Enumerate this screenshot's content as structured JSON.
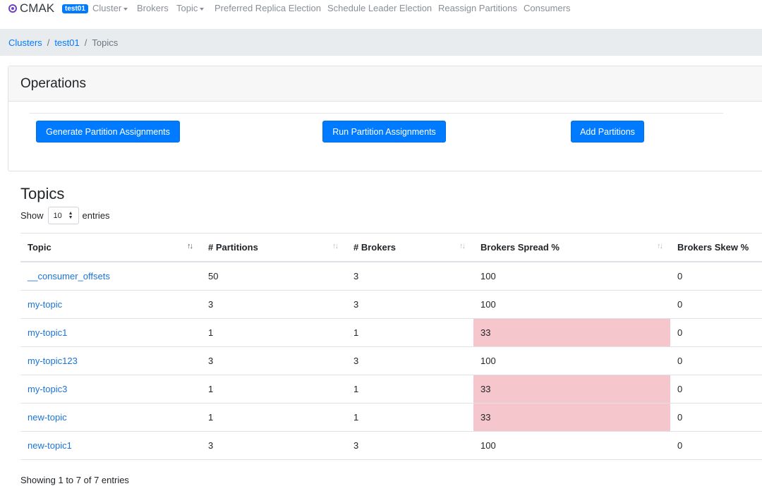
{
  "navbar": {
    "brand": "CMAK",
    "cluster_badge": "test01",
    "items": [
      "Cluster",
      "Brokers",
      "Topic",
      "Preferred Replica Election",
      "Schedule Leader Election",
      "Reassign Partitions",
      "Consumers"
    ]
  },
  "breadcrumb": {
    "items": [
      "Clusters",
      "test01"
    ],
    "active": "Topics"
  },
  "operations": {
    "title": "Operations",
    "buttons": [
      "Generate Partition Assignments",
      "Run Partition Assignments",
      "Add Partitions"
    ]
  },
  "topics": {
    "title": "Topics",
    "show_label": "Show",
    "page_size": "10",
    "entries_label": "entries",
    "columns": [
      "Topic",
      "# Partitions",
      "# Brokers",
      "Brokers Spread %",
      "Brokers Skew %"
    ],
    "rows": [
      {
        "topic": "__consumer_offsets",
        "partitions": "50",
        "brokers": "3",
        "spread": "100",
        "skew": "0",
        "spread_low": false
      },
      {
        "topic": "my-topic",
        "partitions": "3",
        "brokers": "3",
        "spread": "100",
        "skew": "0",
        "spread_low": false
      },
      {
        "topic": "my-topic1",
        "partitions": "1",
        "brokers": "1",
        "spread": "33",
        "skew": "0",
        "spread_low": true
      },
      {
        "topic": "my-topic123",
        "partitions": "3",
        "brokers": "3",
        "spread": "100",
        "skew": "0",
        "spread_low": false
      },
      {
        "topic": "my-topic3",
        "partitions": "1",
        "brokers": "1",
        "spread": "33",
        "skew": "0",
        "spread_low": true
      },
      {
        "topic": "new-topic",
        "partitions": "1",
        "brokers": "1",
        "spread": "33",
        "skew": "0",
        "spread_low": true
      },
      {
        "topic": "new-topic1",
        "partitions": "3",
        "brokers": "3",
        "spread": "100",
        "skew": "0",
        "spread_low": false
      }
    ],
    "footer": "Showing 1 to 7 of 7 entries"
  },
  "colors": {
    "primary": "#007bff",
    "danger_cell": "#f5c6cb",
    "link": "#1a73d9"
  }
}
